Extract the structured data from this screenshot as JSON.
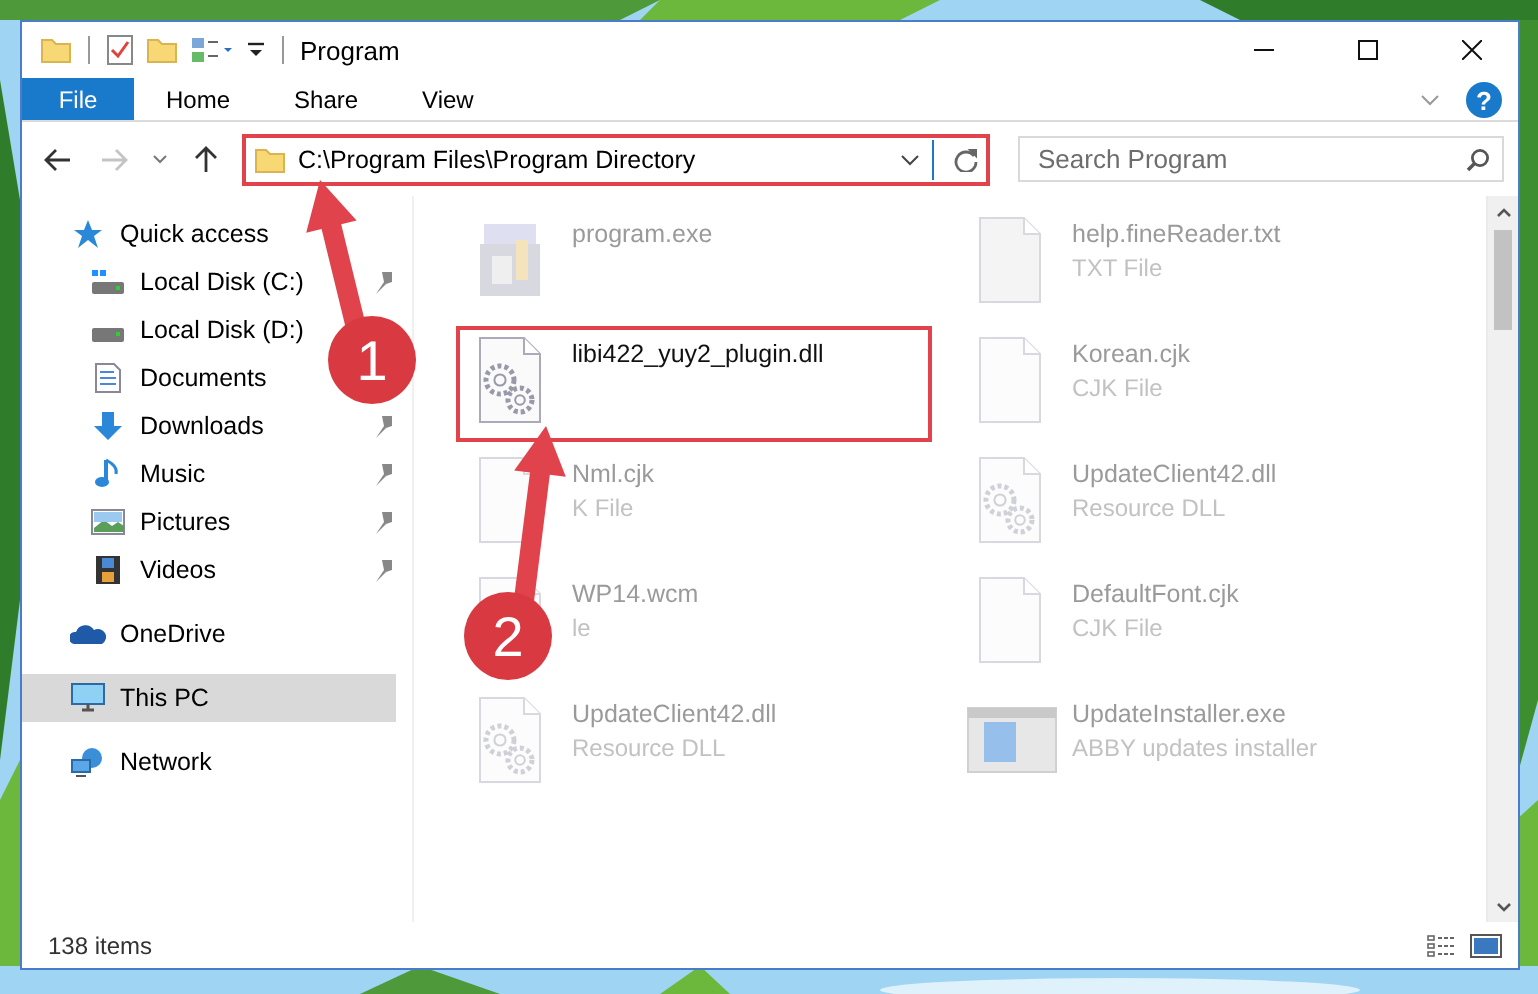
{
  "window": {
    "title": "Program"
  },
  "ribbon": {
    "tabs": [
      {
        "label": "File",
        "kind": "file"
      },
      {
        "label": "Home",
        "kind": "tab"
      },
      {
        "label": "Share",
        "kind": "tab"
      },
      {
        "label": "View",
        "kind": "tab"
      }
    ],
    "help": "?"
  },
  "address_bar": {
    "path": "C:\\Program Files\\Program Directory",
    "highlighted": true
  },
  "search": {
    "placeholder": "Search Program"
  },
  "sidebar": {
    "items": [
      {
        "label": "Quick access",
        "kind": "star",
        "selected": false,
        "children": [
          {
            "label": "Local Disk (C:)",
            "kind": "system-drive",
            "pinned": true,
            "selected": false
          },
          {
            "label": "Local Disk (D:)",
            "kind": "drive",
            "selected": false
          },
          {
            "label": "Documents",
            "kind": "documents",
            "selected": false
          },
          {
            "label": "Downloads",
            "kind": "downloads",
            "pinned": true,
            "selected": false
          },
          {
            "label": "Music",
            "kind": "music",
            "pinned": true,
            "selected": false
          },
          {
            "label": "Pictures",
            "kind": "pictures",
            "pinned": true,
            "selected": false
          },
          {
            "label": "Videos",
            "kind": "videos",
            "pinned": true,
            "selected": false
          }
        ]
      },
      {
        "label": "OneDrive",
        "kind": "cloud",
        "selected": false
      },
      {
        "label": "This PC",
        "kind": "pc",
        "selected": true
      },
      {
        "label": "Network",
        "kind": "network",
        "selected": false
      }
    ]
  },
  "files": [
    {
      "name": "program.exe",
      "kind": "exe",
      "faded": true,
      "highlighted": false
    },
    {
      "name": "help.fineReader.txt",
      "type": "TXT File",
      "kind": "txt",
      "faded": true,
      "highlighted": false
    },
    {
      "name": "libi422_yuy2_plugin.dll",
      "kind": "dll",
      "faded": false,
      "highlighted": true
    },
    {
      "name": "Korean.cjk",
      "type": "CJK File",
      "kind": "blank",
      "faded": true,
      "highlighted": false
    },
    {
      "name": "Nml.cjk",
      "type": "K File",
      "kind": "blank",
      "faded": true,
      "highlighted": false
    },
    {
      "name": "UpdateClient42.dll",
      "type": "Resource DLL",
      "kind": "dll",
      "faded": true,
      "highlighted": false
    },
    {
      "name": "WP14.wcm",
      "type": "le",
      "kind": "blank",
      "faded": true,
      "highlighted": false
    },
    {
      "name": "DefaultFont.cjk",
      "type": "CJK File",
      "kind": "blank",
      "faded": true,
      "highlighted": false
    },
    {
      "name": "UpdateClient42.dll",
      "type": "Resource DLL",
      "kind": "dll",
      "faded": true,
      "highlighted": false
    },
    {
      "name": "UpdateInstaller.exe",
      "type": "ABBY updates installer",
      "kind": "installer",
      "faded": true,
      "highlighted": false
    }
  ],
  "status_bar": {
    "item_count": "138 items"
  },
  "annotations": [
    {
      "label": "1"
    },
    {
      "label": "2"
    }
  ]
}
